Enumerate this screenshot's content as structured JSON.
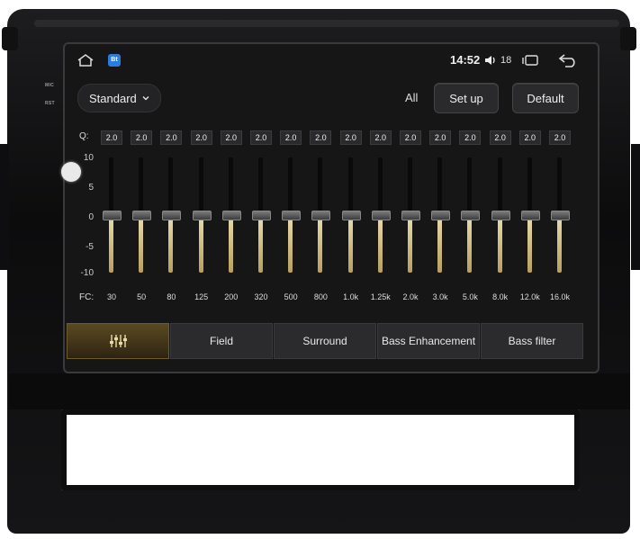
{
  "hardware": {
    "mic_label": "MIC",
    "rst_label": "RST"
  },
  "status": {
    "time": "14:52",
    "volume": "18",
    "app_icon_text": "Bt"
  },
  "toolbar": {
    "preset": "Standard",
    "all_label": "All",
    "setup_label": "Set up",
    "default_label": "Default"
  },
  "equalizer": {
    "q_label": "Q:",
    "fc_label": "FC:",
    "scale": [
      "10",
      "5",
      "0",
      "-5",
      "-10"
    ],
    "bands": [
      {
        "q": "2.0",
        "fc": "30",
        "level": 0
      },
      {
        "q": "2.0",
        "fc": "50",
        "level": 0
      },
      {
        "q": "2.0",
        "fc": "80",
        "level": 0
      },
      {
        "q": "2.0",
        "fc": "125",
        "level": 0
      },
      {
        "q": "2.0",
        "fc": "200",
        "level": 0
      },
      {
        "q": "2.0",
        "fc": "320",
        "level": 0
      },
      {
        "q": "2.0",
        "fc": "500",
        "level": 0
      },
      {
        "q": "2.0",
        "fc": "800",
        "level": 0
      },
      {
        "q": "2.0",
        "fc": "1.0k",
        "level": 0
      },
      {
        "q": "2.0",
        "fc": "1.25k",
        "level": 0
      },
      {
        "q": "2.0",
        "fc": "2.0k",
        "level": 0
      },
      {
        "q": "2.0",
        "fc": "3.0k",
        "level": 0
      },
      {
        "q": "2.0",
        "fc": "5.0k",
        "level": 0
      },
      {
        "q": "2.0",
        "fc": "8.0k",
        "level": 0
      },
      {
        "q": "2.0",
        "fc": "12.0k",
        "level": 0
      },
      {
        "q": "2.0",
        "fc": "16.0k",
        "level": 0
      }
    ]
  },
  "tabs": [
    {
      "label": "",
      "icon": "equalizer-icon",
      "active": true
    },
    {
      "label": "Field",
      "active": false
    },
    {
      "label": "Surround",
      "active": false
    },
    {
      "label": "Bass Enhancement",
      "active": false
    },
    {
      "label": "Bass filter",
      "active": false
    }
  ],
  "colors": {
    "accent": "#c9b47a",
    "active_tab": "#5a4a22"
  }
}
